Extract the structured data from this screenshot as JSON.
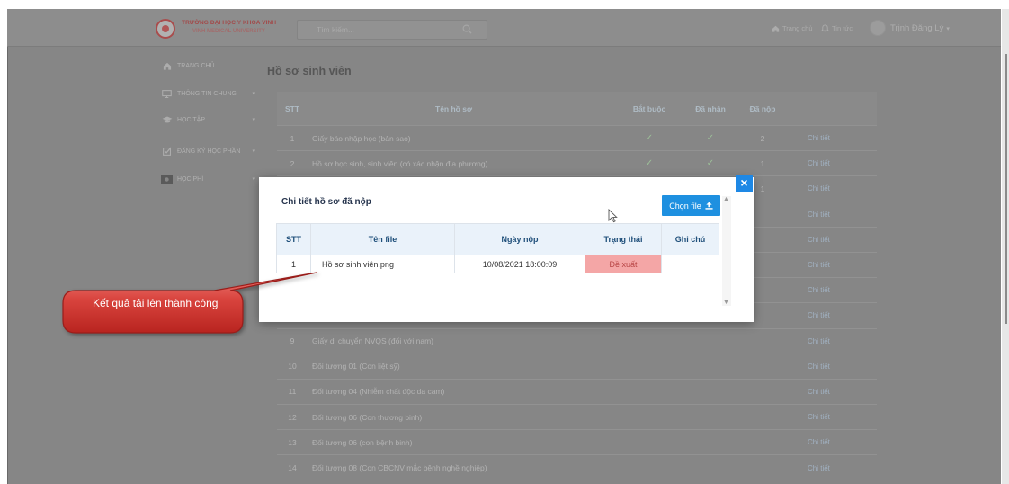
{
  "header": {
    "logo_line1": "TRƯỜNG ĐẠI HỌC Y KHOA VINH",
    "logo_line2": "VINH MEDICAL UNIVERSITY",
    "search_placeholder": "Tìm kiếm...",
    "search_icon": "search-icon",
    "nav_home": "Trang chủ",
    "nav_home_icon": "home-icon",
    "nav_news": "Tin tức",
    "nav_news_icon": "bell-icon",
    "user_name": "Trịnh Đăng Lý"
  },
  "sidebar": {
    "items": [
      {
        "label": "TRANG CHỦ",
        "icon": "home-icon",
        "caret": false
      },
      {
        "label": "THÔNG TIN CHUNG",
        "icon": "monitor-icon",
        "caret": true
      },
      {
        "label": "HỌC TẬP",
        "icon": "graduation-cap-icon",
        "caret": true
      },
      {
        "label": "ĐĂNG KÝ HỌC PHẦN",
        "icon": "checkbox-icon",
        "caret": true
      },
      {
        "label": "HỌC PHÍ",
        "icon": "money-icon",
        "caret": true
      }
    ]
  },
  "main": {
    "title": "Hồ sơ sinh viên",
    "columns": [
      "STT",
      "Tên hồ sơ",
      "Bắt buộc",
      "Đã nhận",
      "Đã nộp"
    ],
    "detail_label": "Chi tiết",
    "rows": [
      {
        "stt": "1",
        "name": "Giấy báo nhập học (bản sao)",
        "required": true,
        "received": true,
        "submitted": "2"
      },
      {
        "stt": "2",
        "name": "Hồ sơ học sinh, sinh viên (có xác nhận địa phương)",
        "required": true,
        "received": true,
        "submitted": "1"
      },
      {
        "stt": "",
        "name": "",
        "required": false,
        "received": false,
        "submitted": "1"
      },
      {
        "stt": "",
        "name": "",
        "required": false,
        "received": false,
        "submitted": ""
      },
      {
        "stt": "",
        "name": "",
        "required": false,
        "received": false,
        "submitted": ""
      },
      {
        "stt": "",
        "name": "",
        "required": false,
        "received": false,
        "submitted": ""
      },
      {
        "stt": "",
        "name": "",
        "required": false,
        "received": false,
        "submitted": ""
      },
      {
        "stt": "",
        "name": "",
        "required": false,
        "received": false,
        "submitted": ""
      },
      {
        "stt": "9",
        "name": "Giấy di chuyển NVQS (đối với nam)",
        "required": false,
        "received": false,
        "submitted": ""
      },
      {
        "stt": "10",
        "name": "Đối tượng 01 (Con liệt sỹ)",
        "required": false,
        "received": false,
        "submitted": ""
      },
      {
        "stt": "11",
        "name": "Đối tượng 04 (Nhiễm chất độc da cam)",
        "required": false,
        "received": false,
        "submitted": ""
      },
      {
        "stt": "12",
        "name": "Đối tượng 06 (Con thương binh)",
        "required": false,
        "received": false,
        "submitted": ""
      },
      {
        "stt": "13",
        "name": "Đối tượng 06 (con bệnh binh)",
        "required": false,
        "received": false,
        "submitted": ""
      },
      {
        "stt": "14",
        "name": "Đối tượng 08 (Con CBCNV mắc bệnh nghề nghiệp)",
        "required": false,
        "received": false,
        "submitted": ""
      }
    ]
  },
  "modal": {
    "title": "Chi tiết hồ sơ đã nộp",
    "choose_file_label": "Chọn file",
    "choose_file_icon": "upload-icon",
    "close_label": "×",
    "columns": [
      "STT",
      "Tên file",
      "Ngày nộp",
      "Trạng thái",
      "Ghi chú"
    ],
    "rows": [
      {
        "stt": "1",
        "file_name": "Hồ sơ sinh viên.png",
        "submitted_at": "10/08/2021 18:00:09",
        "status": "Đề xuất",
        "note": ""
      }
    ]
  },
  "callout": {
    "text": "Kết quả tải lên thành công"
  },
  "colors": {
    "primary_button": "#1e90e0",
    "close_button": "#1e88e5",
    "status_badge_bg": "#f4a6a6",
    "callout_fill": "#c9302c",
    "modal_header_bg": "#eaf2fa"
  }
}
